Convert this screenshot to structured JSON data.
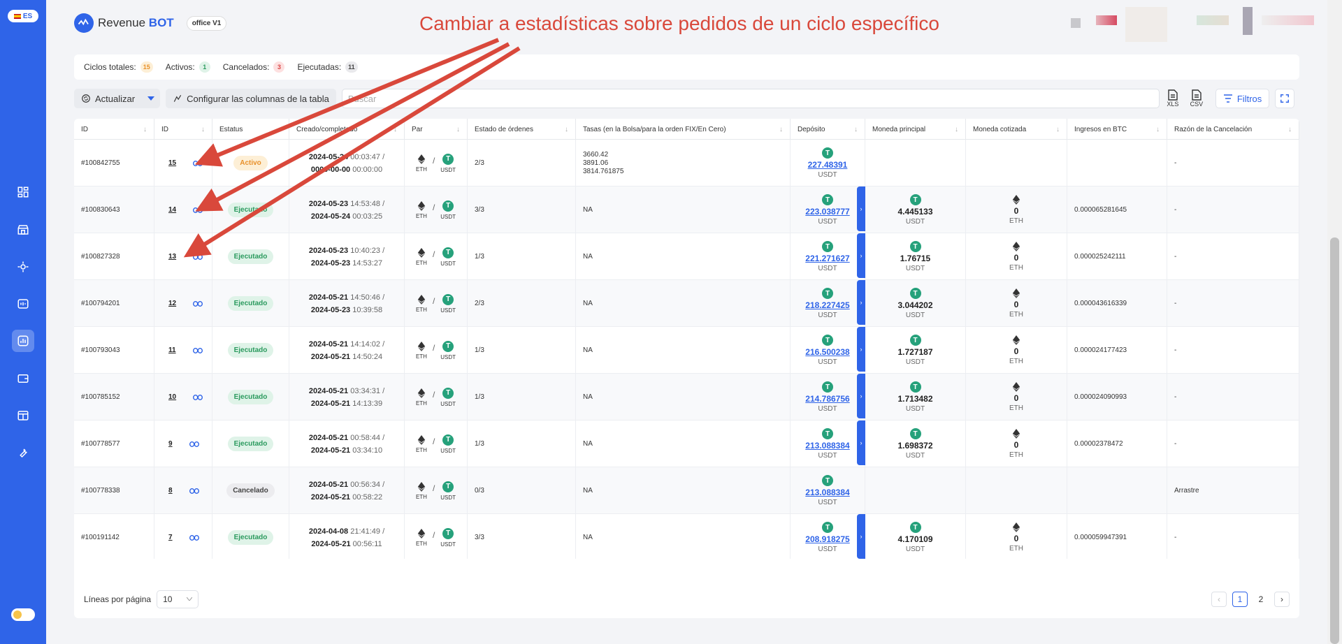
{
  "language": "ES",
  "brand": {
    "name_part1": "Revenue",
    "name_part2": "BOT",
    "badge": "office V1"
  },
  "annotation": "Cambiar a estadísticas sobre pedidos de un ciclo específico",
  "stats": [
    {
      "label": "Ciclos totales:",
      "value": "15",
      "color": "orange"
    },
    {
      "label": "Activos:",
      "value": "1",
      "color": "green"
    },
    {
      "label": "Cancelados:",
      "value": "3",
      "color": "red"
    },
    {
      "label": "Ejecutadas:",
      "value": "11",
      "color": "gray"
    }
  ],
  "toolbar": {
    "refresh_label": "Actualizar",
    "columns_label": "Configurar las columnas de la tabla",
    "search_placeholder": "Buscar",
    "xls_label": "XLS",
    "csv_label": "CSV",
    "filters_label": "Filtros"
  },
  "columns": [
    "ID",
    "ID",
    "Estatus",
    "Creado/completado",
    "Par",
    "Estado de órdenes",
    "Tasas (en la Bolsa/para la orden FIX/En Cero)",
    "Depósito",
    "Moneda principal",
    "Moneda cotizada",
    "Ingresos en BTC",
    "Razón de la Cancelación"
  ],
  "rows": [
    {
      "id": "#100842755",
      "cycle": "15",
      "status": "Activo",
      "status_type": "active",
      "created_date": "2024-05-24",
      "created_time": "00:03:47 /",
      "done_date": "0000-00-00",
      "done_time": "00:00:00",
      "base": "ETH",
      "quote": "USDT",
      "orders": "2/3",
      "rates": [
        "3660.42",
        "3891.06",
        "3814.761875"
      ],
      "deposit": "227.48391",
      "deposit_unit": "USDT",
      "principal": "",
      "principal_unit": "",
      "quoted": "",
      "quoted_unit": "",
      "btc": "",
      "reason": "-"
    },
    {
      "id": "#100830643",
      "cycle": "14",
      "status": "Ejecutado",
      "status_type": "exec",
      "created_date": "2024-05-23",
      "created_time": "14:53:48 /",
      "done_date": "2024-05-24",
      "done_time": "00:03:25",
      "base": "ETH",
      "quote": "USDT",
      "orders": "3/3",
      "rates": [
        "NA"
      ],
      "deposit": "223.038777",
      "deposit_unit": "USDT",
      "principal": "4.445133",
      "principal_unit": "USDT",
      "quoted": "0",
      "quoted_unit": "ETH",
      "btc": "0.000065281645",
      "reason": "-"
    },
    {
      "id": "#100827328",
      "cycle": "13",
      "status": "Ejecutado",
      "status_type": "exec",
      "created_date": "2024-05-23",
      "created_time": "10:40:23 /",
      "done_date": "2024-05-23",
      "done_time": "14:53:27",
      "base": "ETH",
      "quote": "USDT",
      "orders": "1/3",
      "rates": [
        "NA"
      ],
      "deposit": "221.271627",
      "deposit_unit": "USDT",
      "principal": "1.76715",
      "principal_unit": "USDT",
      "quoted": "0",
      "quoted_unit": "ETH",
      "btc": "0.000025242111",
      "reason": "-"
    },
    {
      "id": "#100794201",
      "cycle": "12",
      "status": "Ejecutado",
      "status_type": "exec",
      "created_date": "2024-05-21",
      "created_time": "14:50:46 /",
      "done_date": "2024-05-23",
      "done_time": "10:39:58",
      "base": "ETH",
      "quote": "USDT",
      "orders": "2/3",
      "rates": [
        "NA"
      ],
      "deposit": "218.227425",
      "deposit_unit": "USDT",
      "principal": "3.044202",
      "principal_unit": "USDT",
      "quoted": "0",
      "quoted_unit": "ETH",
      "btc": "0.000043616339",
      "reason": "-"
    },
    {
      "id": "#100793043",
      "cycle": "11",
      "status": "Ejecutado",
      "status_type": "exec",
      "created_date": "2024-05-21",
      "created_time": "14:14:02 /",
      "done_date": "2024-05-21",
      "done_time": "14:50:24",
      "base": "ETH",
      "quote": "USDT",
      "orders": "1/3",
      "rates": [
        "NA"
      ],
      "deposit": "216.500238",
      "deposit_unit": "USDT",
      "principal": "1.727187",
      "principal_unit": "USDT",
      "quoted": "0",
      "quoted_unit": "ETH",
      "btc": "0.000024177423",
      "reason": "-"
    },
    {
      "id": "#100785152",
      "cycle": "10",
      "status": "Ejecutado",
      "status_type": "exec",
      "created_date": "2024-05-21",
      "created_time": "03:34:31 /",
      "done_date": "2024-05-21",
      "done_time": "14:13:39",
      "base": "ETH",
      "quote": "USDT",
      "orders": "1/3",
      "rates": [
        "NA"
      ],
      "deposit": "214.786756",
      "deposit_unit": "USDT",
      "principal": "1.713482",
      "principal_unit": "USDT",
      "quoted": "0",
      "quoted_unit": "ETH",
      "btc": "0.000024090993",
      "reason": "-"
    },
    {
      "id": "#100778577",
      "cycle": "9",
      "status": "Ejecutado",
      "status_type": "exec",
      "created_date": "2024-05-21",
      "created_time": "00:58:44 /",
      "done_date": "2024-05-21",
      "done_time": "03:34:10",
      "base": "ETH",
      "quote": "USDT",
      "orders": "1/3",
      "rates": [
        "NA"
      ],
      "deposit": "213.088384",
      "deposit_unit": "USDT",
      "principal": "1.698372",
      "principal_unit": "USDT",
      "quoted": "0",
      "quoted_unit": "ETH",
      "btc": "0.00002378472",
      "reason": "-"
    },
    {
      "id": "#100778338",
      "cycle": "8",
      "status": "Cancelado",
      "status_type": "cancel",
      "created_date": "2024-05-21",
      "created_time": "00:56:34 /",
      "done_date": "2024-05-21",
      "done_time": "00:58:22",
      "base": "ETH",
      "quote": "USDT",
      "orders": "0/3",
      "rates": [
        "NA"
      ],
      "deposit": "213.088384",
      "deposit_unit": "USDT",
      "principal": "",
      "principal_unit": "",
      "quoted": "",
      "quoted_unit": "",
      "btc": "",
      "reason": "Arrastre"
    },
    {
      "id": "#100191142",
      "cycle": "7",
      "status": "Ejecutado",
      "status_type": "exec",
      "created_date": "2024-04-08",
      "created_time": "21:41:49 /",
      "done_date": "2024-05-21",
      "done_time": "00:56:11",
      "base": "ETH",
      "quote": "USDT",
      "orders": "3/3",
      "rates": [
        "NA"
      ],
      "deposit": "208.918275",
      "deposit_unit": "USDT",
      "principal": "4.170109",
      "principal_unit": "USDT",
      "quoted": "0",
      "quoted_unit": "ETH",
      "btc": "0.000059947391",
      "reason": "-"
    }
  ],
  "footer": {
    "rows_per_page_label": "Líneas por página",
    "rows_per_page_value": "10",
    "pages": [
      "1",
      "2"
    ],
    "current_page": "1"
  },
  "colors": {
    "primary": "#2f64e8",
    "annotation": "#d9483b",
    "tether": "#26a17b"
  }
}
